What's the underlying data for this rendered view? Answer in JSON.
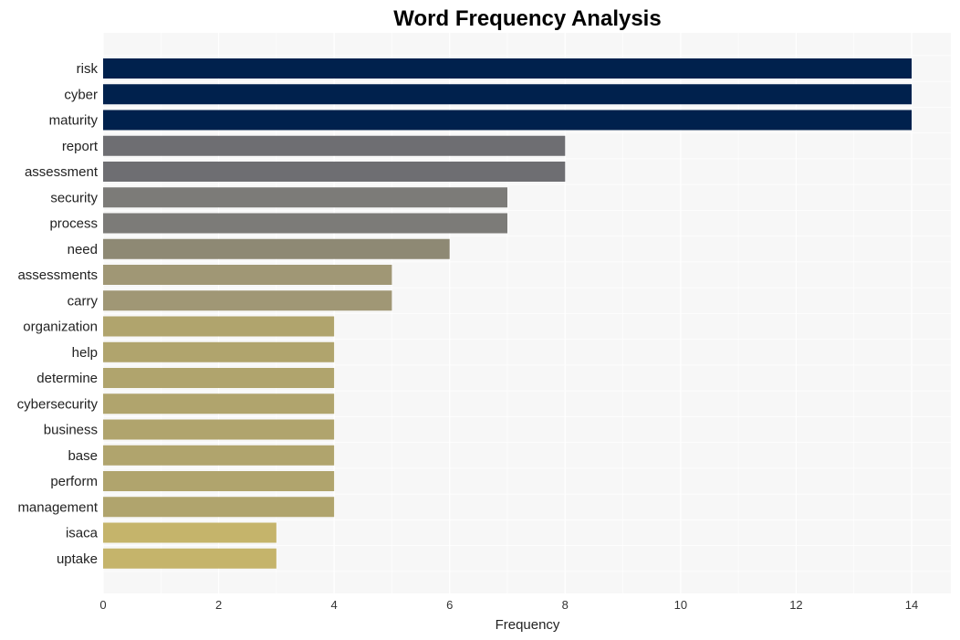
{
  "chart_data": {
    "type": "bar",
    "orientation": "horizontal",
    "title": "Word Frequency Analysis",
    "xlabel": "Frequency",
    "ylabel": "",
    "xlim": [
      0,
      14.7
    ],
    "xticks": [
      0,
      2,
      4,
      6,
      8,
      10,
      12,
      14
    ],
    "grid": true,
    "categories": [
      "risk",
      "cyber",
      "maturity",
      "report",
      "assessment",
      "security",
      "process",
      "need",
      "assessments",
      "carry",
      "organization",
      "help",
      "determine",
      "cybersecurity",
      "business",
      "base",
      "perform",
      "management",
      "isaca",
      "uptake"
    ],
    "values": [
      14,
      14,
      14,
      8,
      8,
      7,
      7,
      6,
      5,
      5,
      4,
      4,
      4,
      4,
      4,
      4,
      4,
      4,
      3,
      3
    ],
    "colors": [
      "#00214d",
      "#00214d",
      "#00214d",
      "#6e6e72",
      "#6e6e72",
      "#7c7b78",
      "#7c7b78",
      "#8e8974",
      "#a09775",
      "#a09775",
      "#b0a46d",
      "#b0a46d",
      "#b0a46d",
      "#b0a46d",
      "#b0a46d",
      "#b0a46d",
      "#b0a46d",
      "#b0a46d",
      "#c5b46b",
      "#c5b46b"
    ],
    "plot_background": "#f7f7f7",
    "grid_color": "#ffffff"
  }
}
